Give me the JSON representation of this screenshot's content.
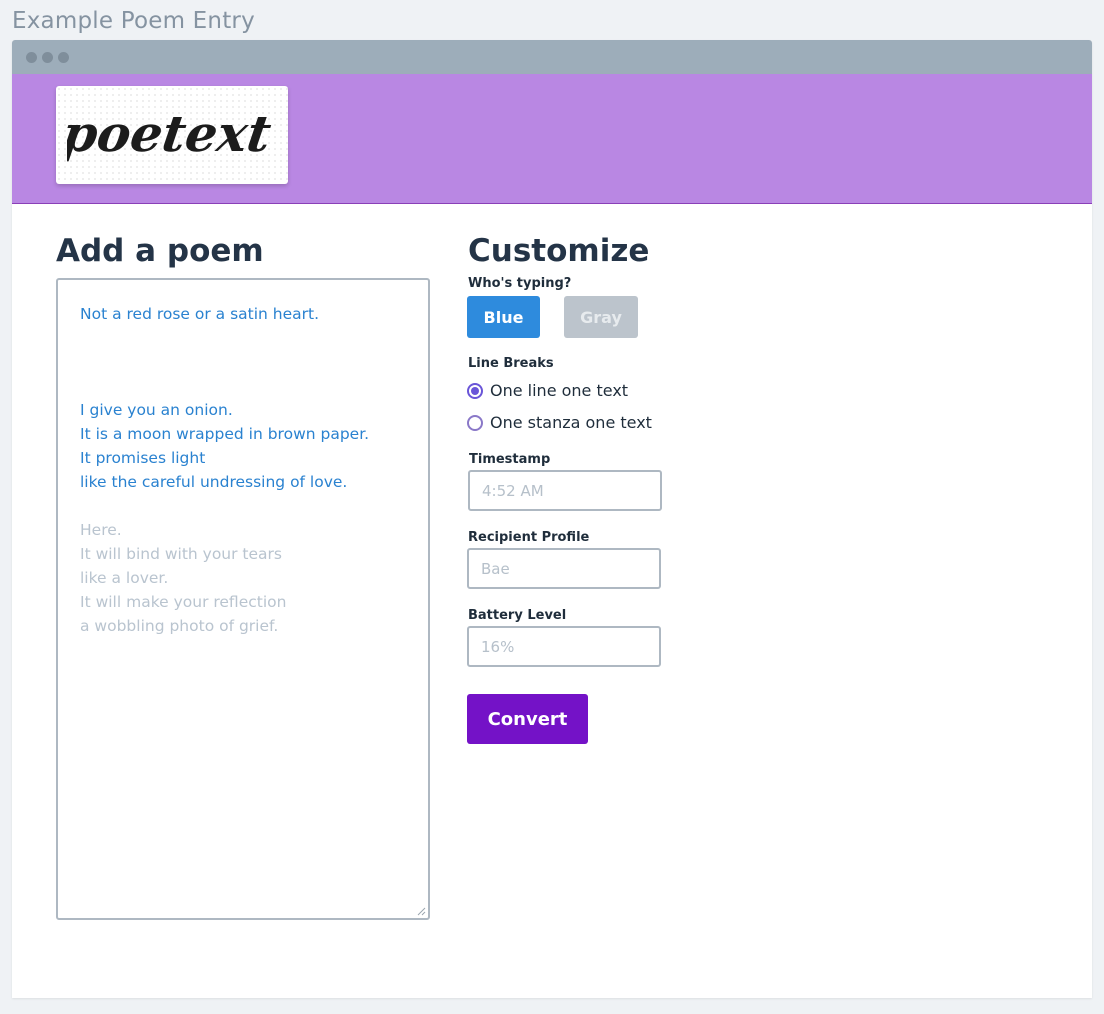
{
  "page_caption": "Example Poem Entry",
  "logo": {
    "text": "poetext"
  },
  "poem": {
    "heading": "Add a poem",
    "lines": [
      {
        "text": "Not a red rose or a satin heart.",
        "style": "blue"
      },
      {
        "text": "",
        "style": "blank"
      },
      {
        "text": "",
        "style": "blank"
      },
      {
        "text": "",
        "style": "blank"
      },
      {
        "text": "I give you an onion.",
        "style": "blue"
      },
      {
        "text": "It is a moon wrapped in brown paper.",
        "style": "blue"
      },
      {
        "text": "It promises light",
        "style": "blue"
      },
      {
        "text": "like the careful undressing of love.",
        "style": "blue"
      },
      {
        "text": "",
        "style": "blank"
      },
      {
        "text": "Here.",
        "style": "gray"
      },
      {
        "text": "It will bind with your tears",
        "style": "gray"
      },
      {
        "text": "like a lover.",
        "style": "gray"
      },
      {
        "text": "It will make your reflection",
        "style": "gray"
      },
      {
        "text": "a wobbling photo of grief.",
        "style": "gray"
      }
    ]
  },
  "customize": {
    "heading": "Customize",
    "whos_typing_label": "Who's typing?",
    "blue_button": "Blue",
    "gray_button": "Gray",
    "line_breaks_label": "Line Breaks",
    "radio_one_line": "One line one text",
    "radio_one_stanza": "One stanza one text",
    "timestamp_label": "Timestamp",
    "timestamp_placeholder": "4:52 AM",
    "recipient_label": "Recipient Profile",
    "recipient_placeholder": "Bae",
    "battery_label": "Battery Level",
    "battery_placeholder": "16%",
    "convert_button": "Convert"
  },
  "colors": {
    "banner": "#b987e3",
    "accent_blue": "#2e8bdd",
    "convert_purple": "#7412c7",
    "radio_purple": "#6a55d8"
  }
}
